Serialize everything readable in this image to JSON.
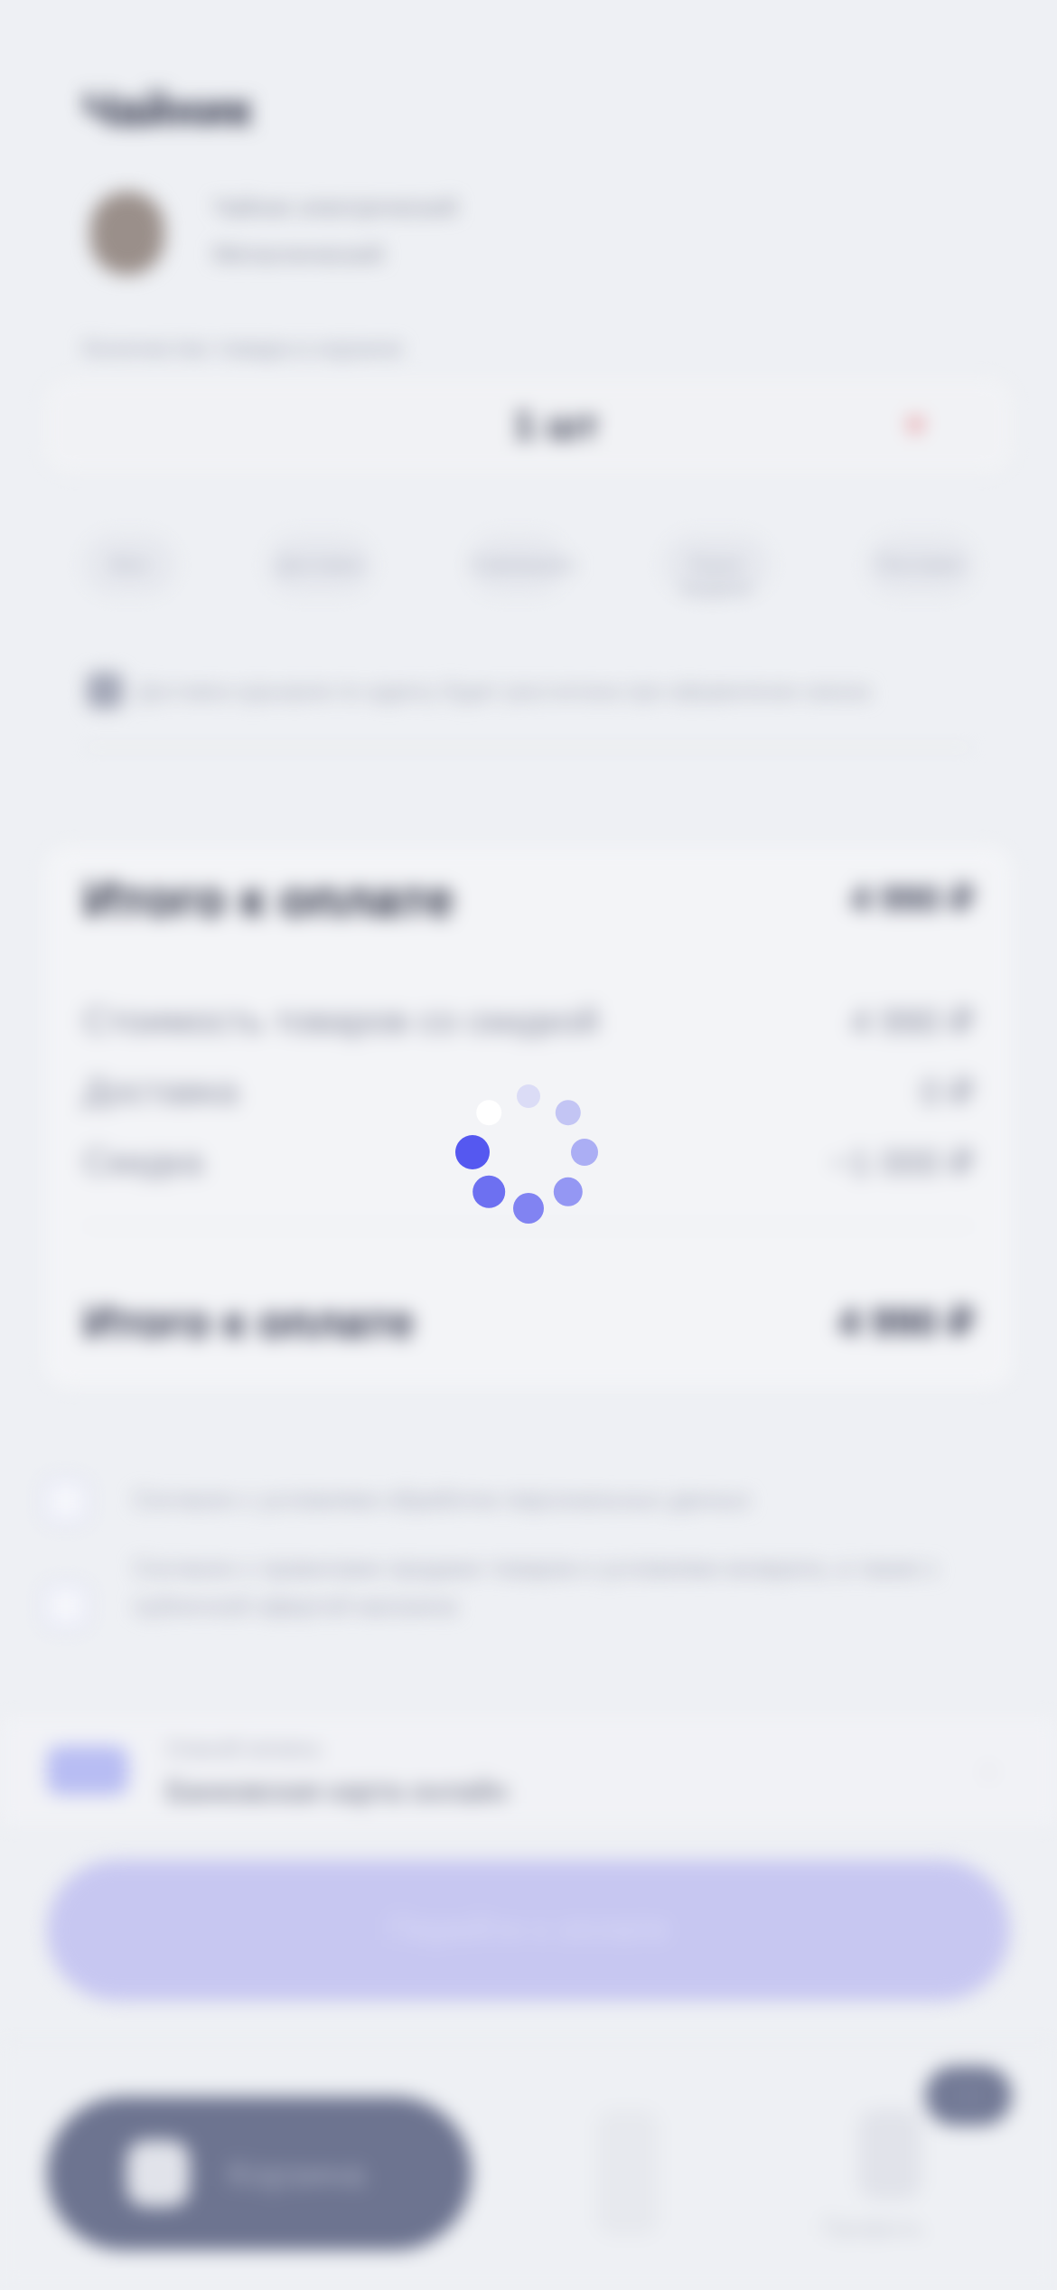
{
  "header": {
    "title": "Чайник"
  },
  "product": {
    "name": "Чайник электрический",
    "subtitle": "Металлический",
    "quantity_note": "Количество товара в корзине",
    "quantity": "1 шт",
    "remove_icon": "heart-icon"
  },
  "filters": [
    "Все",
    "Доставка",
    "Самовывоз",
    "Пункт выдачи",
    "Постамат"
  ],
  "delivery_notice": "Доставка курьером по адресу будет рассчитана при оформлении заказа",
  "summary": {
    "title": "Итого к оплате",
    "total_top": "4 990 ₽",
    "rows": [
      {
        "label": "Стоимость товаров со скидкой",
        "value": "4 990 ₽"
      },
      {
        "label": "Доставка",
        "value": "0 ₽"
      },
      {
        "label": "Скидка",
        "value": "−1 000 ₽"
      }
    ],
    "grand_label": "Итого к оплате",
    "grand_value": "4 990 ₽"
  },
  "agreements": [
    "Согласен с условиями обработки персональных данных",
    "Согласен с правилами продажи товаров и условиями возврата, а также с публичной офертой магазина"
  ],
  "payment": {
    "caption": "Способ оплаты",
    "method": "Банковская карта онлайн"
  },
  "cta": {
    "label": "Перейти к оплате"
  },
  "bottom_nav": {
    "primary_label": "Корзина",
    "badge": "1",
    "secondary_label": "Профиль"
  },
  "loader": {
    "accent": "#5558f0"
  }
}
